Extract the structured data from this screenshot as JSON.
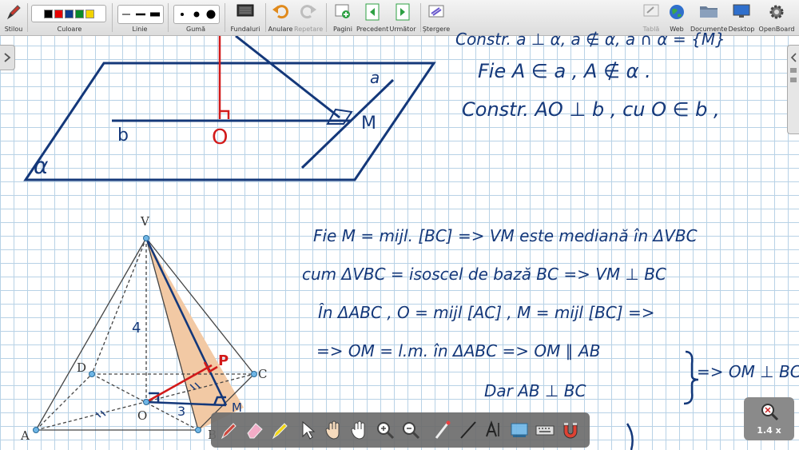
{
  "toolbar": {
    "pen": "Stilou",
    "color": "Culoare",
    "line": "Linie",
    "eraser": "Gumă",
    "backgrounds": "Fundaluri",
    "undo": "Anulare",
    "redo": "Repetare",
    "pages": "Pagini",
    "previous": "Precedent",
    "next": "Următor",
    "clear": "Ștergere",
    "board": "Tablă",
    "web": "Web",
    "documents": "Documente",
    "desktop": "Desktop",
    "openboard": "OpenBoard",
    "colors": [
      "#000000",
      "#e60000",
      "#0e3c8c",
      "#0a8a2a",
      "#f2d300"
    ]
  },
  "zoom": {
    "label": "1.4 x"
  },
  "figure_top": {
    "plane_label": "α",
    "line_label_b": "b",
    "line_label_a": "a",
    "point_o": "O",
    "point_m": "M"
  },
  "pyramid": {
    "v": "V",
    "a": "A",
    "b": "B",
    "c": "C",
    "d": "D",
    "o": "O",
    "p": "P",
    "m": "M",
    "height": "4",
    "om_len": "3"
  },
  "notes_top": [
    "Constr. a ⊥ α, a ∉ α, a ∩ α = {M}",
    "Fie A ∈ a , A ∉ α .",
    "Constr. AO ⊥ b , cu O ∈ b ,"
  ],
  "notes_bottom": [
    "Fie M = mijl. [BC] => VM este mediană în ΔVBC",
    "cum ΔVBC = isoscel de bază BC => VM ⊥ BC",
    "În ΔABC , O = mijl [AC] , M = mijl [BC] =>",
    "=> OM = l.m. în ΔABC => OM ∥ AB",
    "Dar AB ⊥ BC",
    "=> OM ⊥ BC"
  ]
}
